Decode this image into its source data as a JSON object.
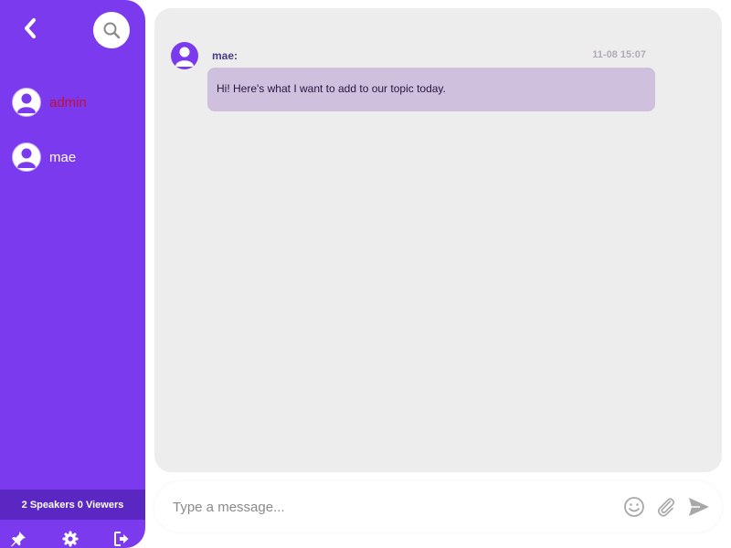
{
  "sidebar": {
    "users": [
      {
        "name": "admin",
        "highlight": true
      },
      {
        "name": "mae",
        "highlight": false
      }
    ],
    "counter": "2 Speakers 0 Viewers",
    "icons": {
      "back": "chevron-left-icon",
      "search": "search-icon",
      "pin": "pin-icon",
      "settings": "gear-icon",
      "exit": "exit-icon"
    }
  },
  "chat": {
    "messages": [
      {
        "sender": "mae:",
        "time": "11-08 15:07",
        "text": "Hi! Here's what I want to add to our topic today."
      }
    ]
  },
  "input": {
    "placeholder": "Type a message...",
    "icons": {
      "emoji": "smiley-icon",
      "attach": "paperclip-icon",
      "send": "send-icon"
    }
  },
  "colors": {
    "accent": "#7b3aed",
    "sidebar_dark": "#5b27c2",
    "bubble": "#cfc0dd",
    "panel": "#ededed",
    "highlight_name": "#c0103a"
  }
}
